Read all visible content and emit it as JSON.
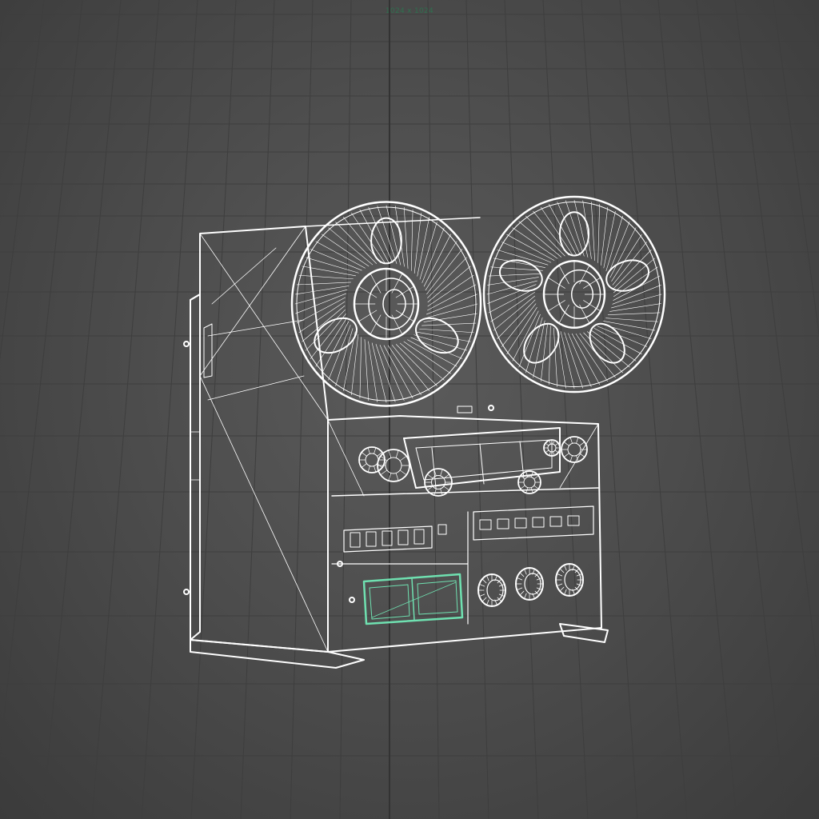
{
  "viewport": {
    "resolution_label": "1024 x 1024",
    "display_mode": "wireframe",
    "background_color": "#4d4d4d",
    "wire_color": "#ffffff",
    "selection_color": "#6fe0b0"
  },
  "model": {
    "icon": "reel-to-reel-tape-recorder-icon",
    "selected_part": "meter-display"
  }
}
